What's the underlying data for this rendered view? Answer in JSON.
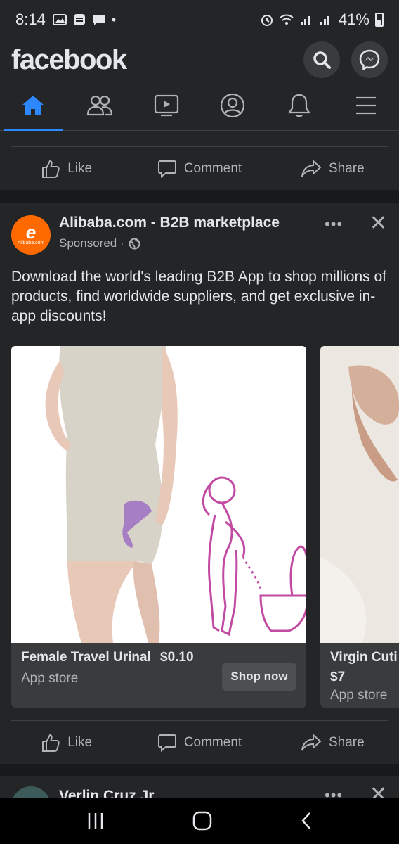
{
  "status_bar": {
    "time": "8:14",
    "battery": "41%"
  },
  "header": {
    "logo": "facebook"
  },
  "nav": {
    "items": [
      {
        "name": "home",
        "active": true
      },
      {
        "name": "friends",
        "active": false
      },
      {
        "name": "watch",
        "active": false
      },
      {
        "name": "profile",
        "active": false
      },
      {
        "name": "notifications",
        "active": false
      },
      {
        "name": "menu",
        "active": false
      }
    ]
  },
  "actions": {
    "like": "Like",
    "comment": "Comment",
    "share": "Share"
  },
  "post": {
    "advertiser": "Alibaba.com - B2B marketplace",
    "sponsored": "Sponsored ·",
    "avatar_mark": "e",
    "avatar_sub": "Alibaba.com",
    "more": "•••",
    "close": "✕",
    "text": "Download the world's leading B2B App to shop millions of products, find worldwide suppliers, and get exclusive in-app discounts!",
    "carousel": [
      {
        "title": "Female Travel Urinal",
        "price": "$0.10",
        "source": "App store",
        "cta": "Shop now"
      },
      {
        "title": "Virgin Cuti",
        "price": "$7",
        "source": "App store"
      }
    ]
  },
  "next_post": {
    "name": "Verlin Cruz Jr"
  },
  "colors": {
    "accent": "#2d88ff",
    "background": "#18191a",
    "card": "#242526",
    "alibaba": "#ff6a00"
  }
}
